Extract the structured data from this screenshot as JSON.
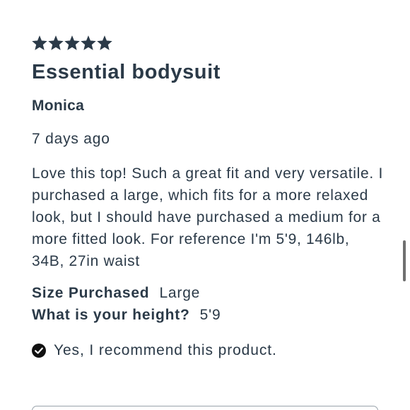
{
  "review": {
    "rating": 5,
    "rating_max": 5,
    "title": "Essential bodysuit",
    "author": "Monica",
    "date": "7 days ago",
    "body": "Love this top! Such a great fit and very versatile. I purchased a large, which fits for a more relaxed look, but I should have purchased a medium for a more fitted look. For reference I'm 5'9, 146lb, 34B, 27in waist",
    "attributes": [
      {
        "label": "Size Purchased",
        "value": "Large"
      },
      {
        "label": "What is your height?",
        "value": "5'9"
      }
    ],
    "recommend_text": "Yes, I recommend this product."
  },
  "colors": {
    "text": "#2b3a48",
    "star": "#2b3a48",
    "scrollbar": "#6f6f6f"
  },
  "icons": {
    "star": "star-icon",
    "recommend": "check-circle-icon"
  }
}
